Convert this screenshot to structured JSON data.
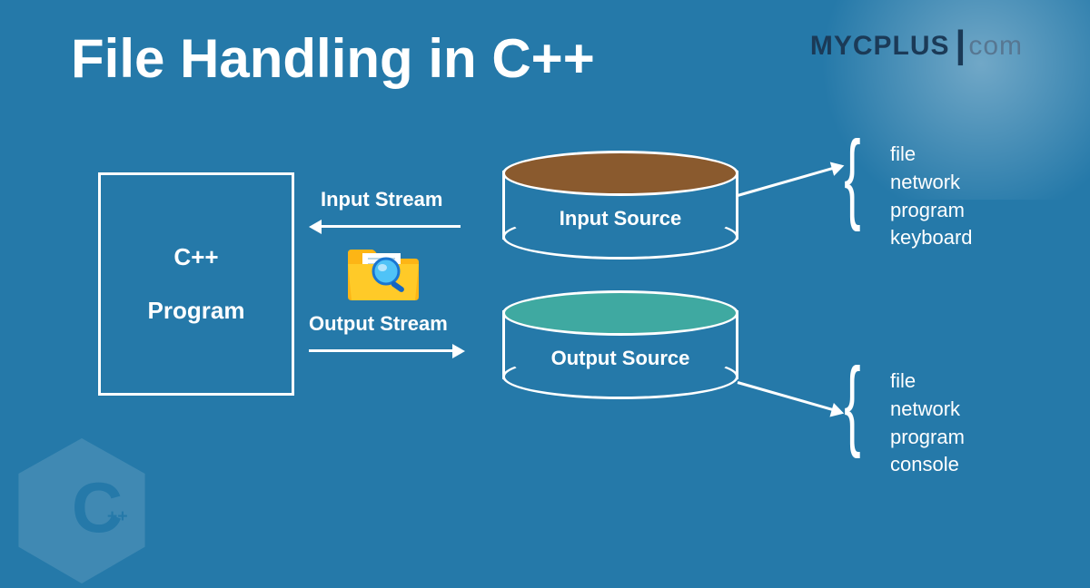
{
  "title": "File Handling in C++",
  "logo": {
    "main": "MYCPLUS",
    "com": "com"
  },
  "program": {
    "line1": "C++",
    "line2": "Program"
  },
  "streams": {
    "input": "Input Stream",
    "output": "Output Stream"
  },
  "sources": {
    "input": "Input Source",
    "output": "Output Source"
  },
  "details": {
    "input": [
      "file",
      "network",
      "program",
      "keyboard"
    ],
    "output": [
      "file",
      "network",
      "program",
      "console"
    ]
  }
}
